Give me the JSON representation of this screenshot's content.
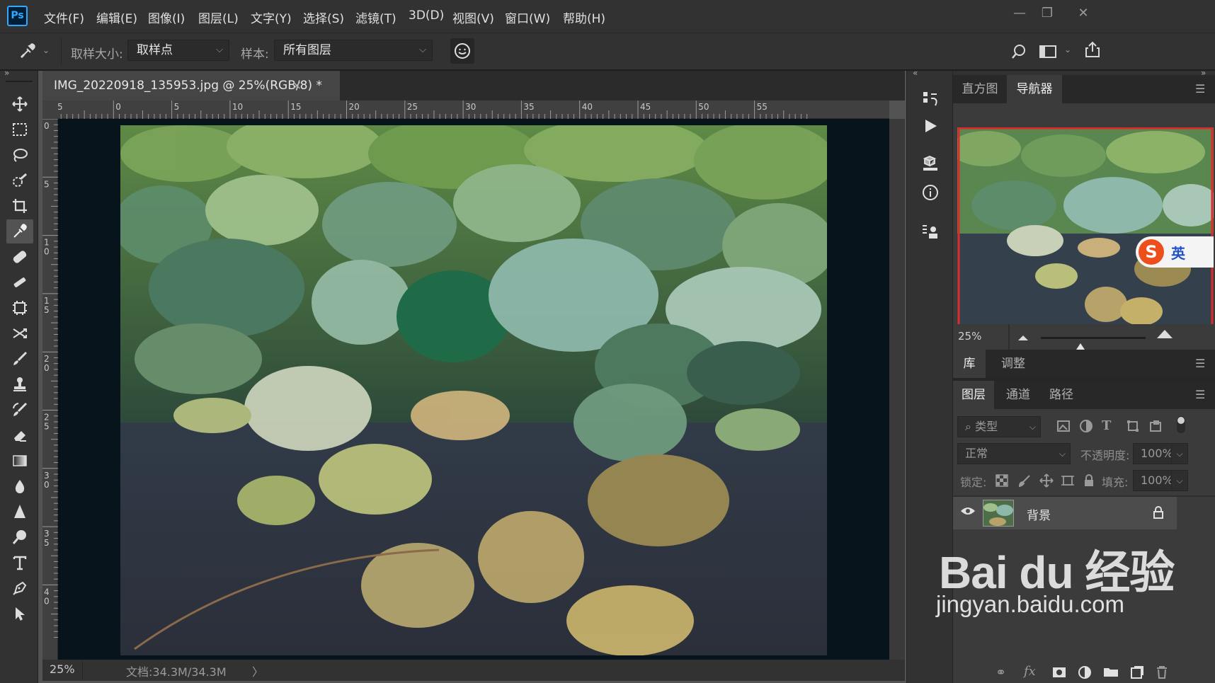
{
  "app": {
    "logo": "Ps"
  },
  "menu": [
    "文件(F)",
    "编辑(E)",
    "图像(I)",
    "图层(L)",
    "文字(Y)",
    "选择(S)",
    "滤镜(T)",
    "3D(D)",
    "视图(V)",
    "窗口(W)",
    "帮助(H)"
  ],
  "window_controls": {
    "minimize": "—",
    "restore": "❐",
    "close": "✕"
  },
  "options": {
    "sample_size_label": "取样大小:",
    "sample_size_value": "取样点",
    "sample_label": "样本:",
    "sample_value": "所有图层"
  },
  "document": {
    "tab_title": "IMG_20220918_135953.jpg @ 25%(RGB/8) *",
    "close": "×",
    "zoom": "25%",
    "doc_info": "文档:34.3M/34.3M",
    "nav_arrow": "〉",
    "ruler_h_labels": [
      "5",
      "0",
      "5",
      "10",
      "15",
      "20",
      "25",
      "30",
      "35",
      "40",
      "45",
      "50",
      "55"
    ],
    "ruler_v_labels": [
      "0",
      "5",
      "1 0",
      "1 5",
      "2 0",
      "2 5",
      "3 0",
      "3 5",
      "4 0"
    ]
  },
  "tools": [
    "move-tool",
    "marquee-tool",
    "lasso-tool",
    "quick-select-tool",
    "crop-tool",
    "eyedropper-tool",
    "healing-tool",
    "brush-tool",
    "patch-tool",
    "content-move-tool",
    "paint-brush-tool",
    "stamp-tool",
    "history-brush-tool",
    "eraser-tool",
    "gradient-tool",
    "blur-tool",
    "sharpen-tool",
    "dodge-tool",
    "type-tool",
    "pen-tool",
    "path-select-tool"
  ],
  "panels": {
    "top_tabs": [
      "直方图",
      "导航器"
    ],
    "navigator_zoom": "25%",
    "navigator_zoom_fraction": 0.38,
    "lib_tabs": [
      "库",
      "调整"
    ],
    "layer_tabs": [
      "图层",
      "通道",
      "路径"
    ],
    "filter_kind": "类型",
    "blend_mode": "正常",
    "opacity_label": "不透明度:",
    "opacity_value": "100%",
    "lock_label": "锁定:",
    "fill_label": "填充:",
    "fill_value": "100%",
    "layer_name": "背景",
    "ime_label": "英"
  },
  "watermark": {
    "brand": "Bai du 经验",
    "url": "jingyan.baidu.com"
  },
  "colors": {
    "accent": "#31a8ff",
    "nav_frame": "#e02a2a"
  }
}
